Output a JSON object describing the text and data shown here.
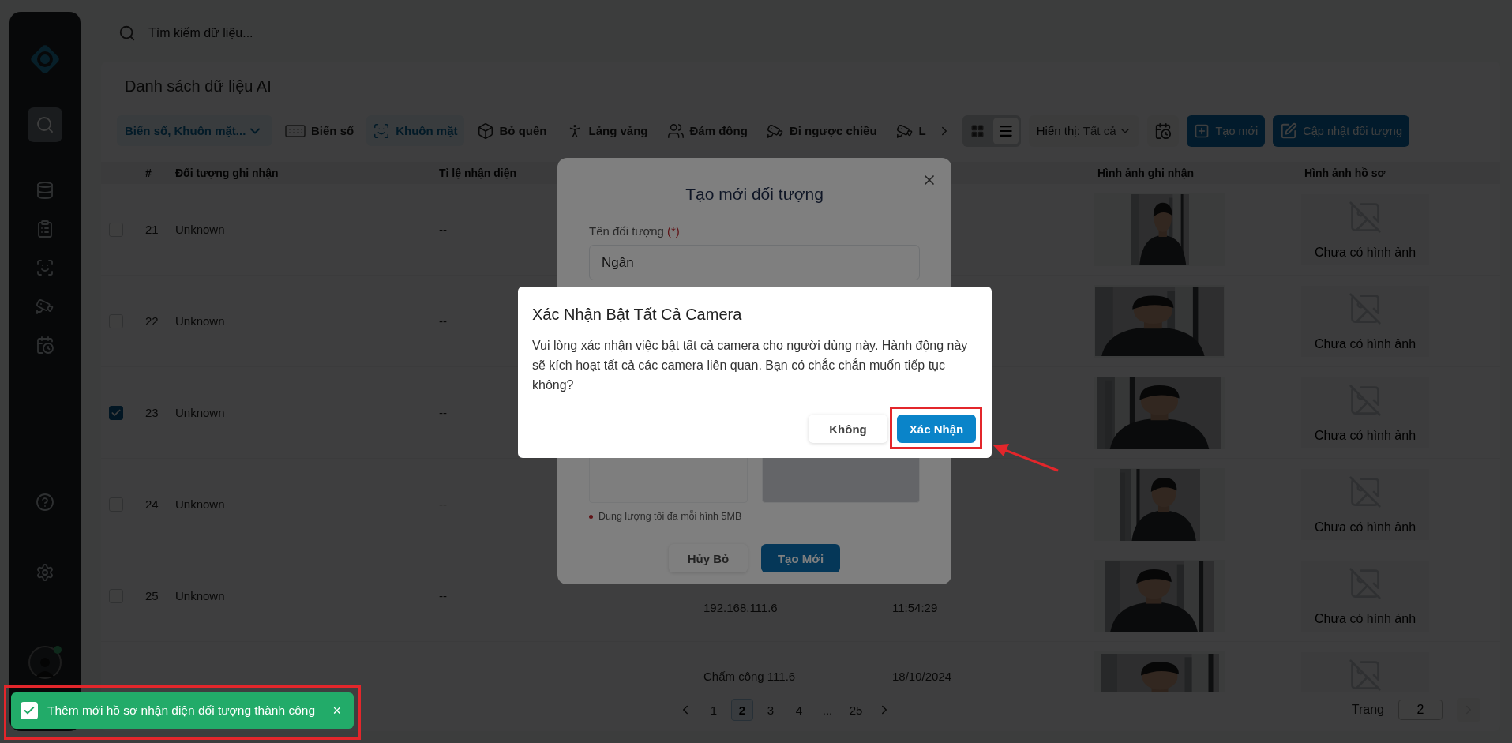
{
  "search": {
    "placeholder": "Tìm kiếm dữ liệu..."
  },
  "sidebar": {
    "items": [
      {
        "selected": true
      },
      {
        "selected": false
      },
      {
        "selected": false
      },
      {
        "selected": false
      },
      {
        "selected": false
      },
      {
        "selected": false
      }
    ]
  },
  "user": {
    "online": true
  },
  "page_title": "Danh sách dữ liệu AI",
  "filter": {
    "value": "Biển số, Khuôn mặt..."
  },
  "tabs": [
    {
      "label": "Biển số",
      "selected": false
    },
    {
      "label": "Khuôn mặt",
      "selected": true
    },
    {
      "label": "Bỏ quên",
      "selected": false
    },
    {
      "label": "Lảng vảng",
      "selected": false
    },
    {
      "label": "Đám đông",
      "selected": false
    },
    {
      "label": "Đi ngược chiều",
      "selected": false
    },
    {
      "label": "L",
      "selected": false
    }
  ],
  "view_modes": [
    {
      "selected": false
    },
    {
      "selected": true
    }
  ],
  "display_filter": {
    "label": "Hiển thị:",
    "value": "Tất cả"
  },
  "actions": [
    "Tạo mới",
    "Cập nhật đối tượng"
  ],
  "table": {
    "header": {
      "number": "#",
      "object": "Đối tượng ghi nhận",
      "rate": "Tỉ lệ nhận diện",
      "captured": "Hình ảnh ghi nhận",
      "profile": "Hình ảnh hồ sơ"
    },
    "rows": [
      {
        "checked": false,
        "number": "21",
        "name": "Unknown",
        "rate": "--",
        "profile": "Chưa có hình ảnh"
      },
      {
        "checked": false,
        "number": "22",
        "name": "Unknown",
        "rate": "--",
        "profile": "Chưa có hình ảnh"
      },
      {
        "checked": true,
        "number": "23",
        "name": "Unknown",
        "rate": "--",
        "profile": "Chưa có hình ảnh"
      },
      {
        "checked": false,
        "number": "24",
        "name": "Unknown",
        "rate": "--",
        "profile": "Chưa có hình ảnh"
      },
      {
        "checked": false,
        "number": "25",
        "name": "Unknown",
        "rate": "--",
        "camera_line_2": "192.168.111.6",
        "time_line_2": "11:54:29",
        "profile": "Chưa có hình ảnh"
      },
      {
        "camera_line_1": "Chấm công 111.6",
        "time_line_1": "18/10/2024"
      }
    ]
  },
  "pagination": {
    "pages": [
      {
        "label": "1",
        "selected": false
      },
      {
        "label": "2",
        "selected": true
      },
      {
        "label": "3",
        "selected": false
      },
      {
        "label": "4",
        "selected": false
      },
      {
        "label": "...",
        "selected": false
      },
      {
        "label": "25",
        "selected": false
      }
    ],
    "page_label": "Trang",
    "page_input": "2"
  },
  "create_dialog": {
    "title": "Tạo mới đối tượng",
    "name_label": "Tên đối tượng",
    "required_mark": "(*)",
    "name_value": "Ngân",
    "note": "Dung lượng tối đa mỗi hình 5MB",
    "buttons": [
      "Hủy Bỏ",
      "Tạo Mới"
    ]
  },
  "confirm_dialog": {
    "title": "Xác Nhận Bật Tất Cả Camera",
    "message": "Vui lòng xác nhận việc bật tất cả camera cho người dùng này. Hành động này sẽ kích hoạt tất cả các camera liên quan. Bạn có chắc chắn muốn tiếp tục không?",
    "buttons": [
      "Không",
      "Xác Nhận"
    ]
  },
  "toast": {
    "message": "Thêm mới hồ sơ nhận diện đối tượng thành công",
    "close": "×"
  }
}
